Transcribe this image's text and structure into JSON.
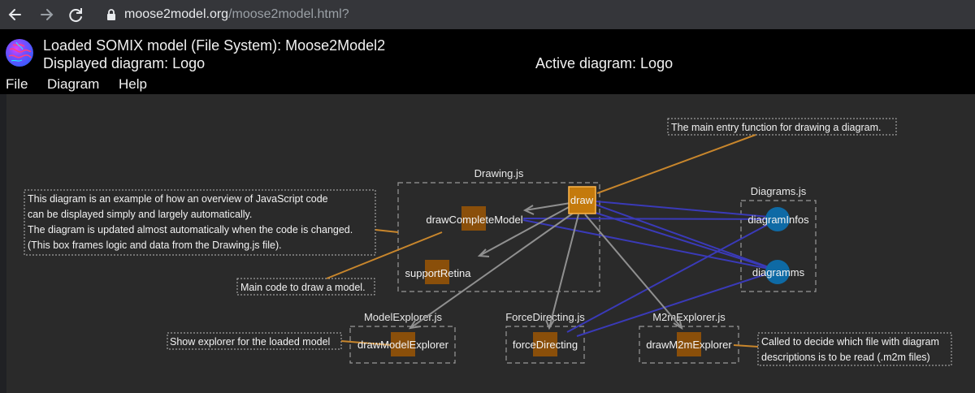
{
  "browser": {
    "url_host": "moose2model.org",
    "url_path": "/moose2model.html?"
  },
  "header": {
    "loaded_model": "Loaded SOMIX model (File System): Moose2Model2",
    "displayed_diagram": "Displayed diagram: Logo",
    "active_diagram": "Active diagram: Logo"
  },
  "menu": {
    "file": "File",
    "diagram": "Diagram",
    "help": "Help"
  },
  "diagram": {
    "groups": {
      "drawing": "Drawing.js",
      "diagrams": "Diagrams.js",
      "model_explorer": "ModelExplorer.js",
      "force_directing": "ForceDirecting.js",
      "m2m_explorer": "M2mExplorer.js"
    },
    "nodes": {
      "draw": "draw",
      "draw_complete_model": "drawCompleteModel",
      "support_retina": "supportRetina",
      "diagram_infos": "diagramInfos",
      "diagramms": "diagramms",
      "draw_model_explorer": "drawModelExplorer",
      "force_directing": "forceDirecting",
      "draw_m2m_explorer": "drawM2mExplorer"
    },
    "comments": {
      "entry": "The main entry function for drawing a diagram.",
      "example": [
        "This diagram is an example of how an overview of JavaScript code",
        "can be displayed simply and largely automatically.",
        "The diagram is updated almost automatically when the code is changed.",
        "(This box frames logic and data from the Drawing.js file)."
      ],
      "main_code": "Main code to draw a model.",
      "explorer": "Show explorer for the loaded model",
      "m2m": [
        "Called to decide which file with diagram",
        "descriptions is to be read (.m2m files)"
      ]
    }
  }
}
